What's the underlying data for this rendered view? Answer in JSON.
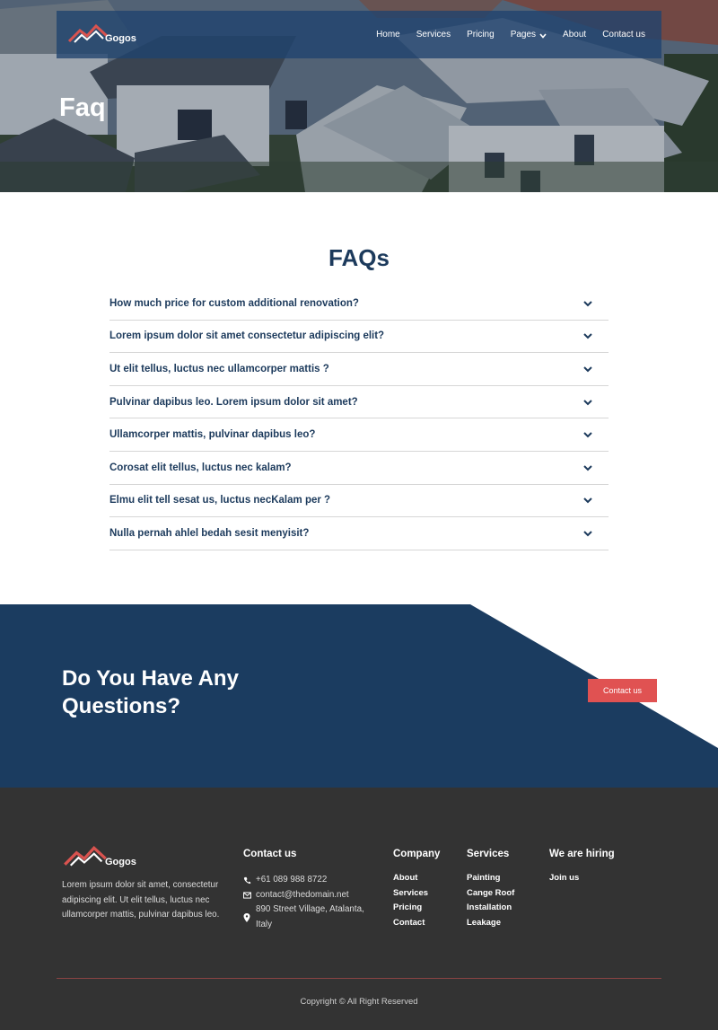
{
  "brand": {
    "name": "Gogos"
  },
  "nav": {
    "items": [
      "Home",
      "Services",
      "Pricing",
      "Pages",
      "About",
      "Contact us"
    ]
  },
  "hero": {
    "title": "Faq"
  },
  "faq": {
    "title": "FAQs",
    "items": [
      "How much price for custom additional renovation?",
      "Lorem ipsum dolor sit amet consectetur adipiscing elit?",
      "Ut elit tellus, luctus nec ullamcorper mattis ?",
      "Pulvinar dapibus leo. Lorem ipsum dolor sit amet?",
      "Ullamcorper mattis, pulvinar dapibus leo?",
      "Corosat elit tellus, luctus nec kalam?",
      "Elmu elit tell sesat us, luctus necKalam per ?",
      "Nulla pernah ahlel bedah sesit menyisit?"
    ]
  },
  "cta": {
    "title": "Do You Have Any Questions?",
    "button": "Contact us"
  },
  "footer": {
    "description": "Lorem ipsum dolor sit amet, consectetur adipiscing elit. Ut elit tellus, luctus nec ullamcorper mattis, pulvinar dapibus leo.",
    "contact": {
      "title": "Contact us",
      "phone": "+61 089 988 8722",
      "email": "contact@thedomain.net",
      "address": "890 Street Village, Atalanta, Italy"
    },
    "company": {
      "title": "Company",
      "links": [
        "About",
        "Services",
        "Pricing",
        "Contact"
      ]
    },
    "services": {
      "title": "Services",
      "links": [
        "Painting",
        "Cange Roof",
        "Installation",
        "Leakage"
      ]
    },
    "hiring": {
      "title": "We are hiring",
      "links": [
        "Join us"
      ]
    },
    "copyright": "Copyright © All Right Reserved"
  },
  "colors": {
    "navy": "#1c3a5c",
    "cta_bg": "#1b3c60",
    "accent": "#e05252",
    "footer_bg": "#333333"
  },
  "icons": [
    "logo-roof-icon",
    "chevron-down-icon",
    "phone-icon",
    "email-icon",
    "location-pin-icon"
  ]
}
